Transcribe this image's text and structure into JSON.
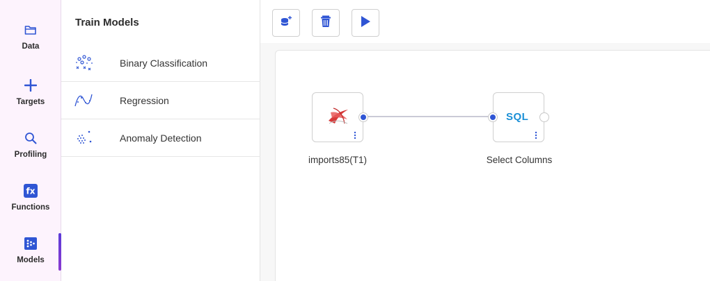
{
  "rail": {
    "items": [
      {
        "label": "Data",
        "icon": "folder-icon"
      },
      {
        "label": "Targets",
        "icon": "plus-icon"
      },
      {
        "label": "Profiling",
        "icon": "search-icon"
      },
      {
        "label": "Functions",
        "icon": "fx-icon"
      },
      {
        "label": "Models",
        "icon": "models-icon"
      }
    ],
    "active": "Models",
    "accent_color": "#6a3ad6"
  },
  "panel": {
    "title": "Train Models",
    "items": [
      {
        "label": "Binary Classification",
        "icon": "binary-classification-icon"
      },
      {
        "label": "Regression",
        "icon": "regression-icon"
      },
      {
        "label": "Anomaly Detection",
        "icon": "anomaly-detection-icon"
      }
    ]
  },
  "toolbar": {
    "buttons": [
      {
        "name": "add-dataset-button",
        "icon": "database-plus-icon"
      },
      {
        "name": "delete-button",
        "icon": "trash-icon"
      },
      {
        "name": "run-button",
        "icon": "play-icon"
      }
    ],
    "icon_color": "#2f55d4"
  },
  "canvas": {
    "nodes": [
      {
        "label": "imports85(T1)",
        "icon": "sql-server-icon"
      },
      {
        "label": "Select Columns",
        "icon_text": "SQL"
      }
    ],
    "connection_color": "#b9b9c8",
    "port_color": "#2f55d4"
  }
}
